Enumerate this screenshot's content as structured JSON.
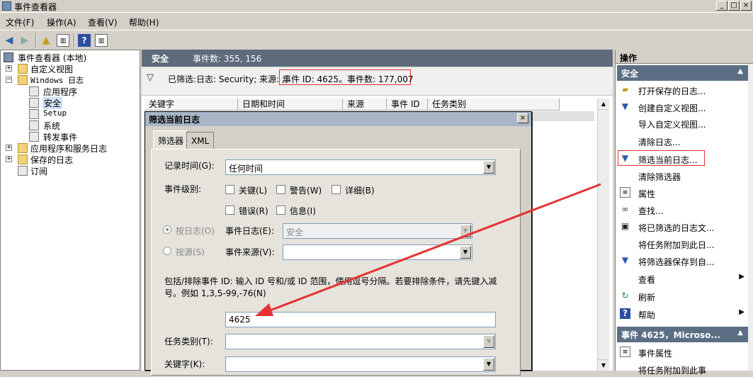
{
  "window": {
    "title": "事件查看器"
  },
  "menu": [
    "文件(F)",
    "操作(A)",
    "查看(V)",
    "帮助(H)"
  ],
  "tree": {
    "items": [
      {
        "label": "事件查看器 (本地)",
        "icon": "event-viewer-icon"
      },
      {
        "label": "自定义视图",
        "icon": "folder-icon"
      },
      {
        "label": "Windows 日志",
        "icon": "folder-icon"
      },
      {
        "label": "应用程序",
        "icon": "log-icon"
      },
      {
        "label": "安全",
        "icon": "log-icon"
      },
      {
        "label": "Setup",
        "icon": "log-icon"
      },
      {
        "label": "系统",
        "icon": "log-icon"
      },
      {
        "label": "转发事件",
        "icon": "log-icon"
      },
      {
        "label": "应用程序和服务日志",
        "icon": "folder-icon"
      },
      {
        "label": "保存的日志",
        "icon": "folder-icon"
      },
      {
        "label": "订阅",
        "icon": "subscription-icon"
      }
    ]
  },
  "center": {
    "log_name": "安全",
    "event_count": "事件数: 355, 156",
    "filter_text": "已筛选:日志: Security; 来源: ;",
    "filter_highlight": "事件 ID: 4625。事件数: 177,007",
    "columns": [
      "关键字",
      "日期和时间",
      "来源",
      "事件 ID",
      "任务类别"
    ]
  },
  "dialog": {
    "title": "筛选当前日志",
    "close": "×",
    "tabs": [
      "筛选器",
      "XML"
    ],
    "logged_label": "记录时间(G):",
    "logged_value": "任何时间",
    "level_label": "事件级别:",
    "levels": [
      "关键(L)",
      "警告(W)",
      "详细(B)",
      "错误(R)",
      "信息(I)"
    ],
    "by_log_label": "按日志(O)",
    "event_logs_label": "事件日志(E):",
    "event_logs_value": "安全",
    "by_source_label": "按源(S)",
    "event_sources_label": "事件来源(V):",
    "event_sources_value": "",
    "id_desc_line1": "包括/排除事件 ID: 输入 ID 号和/或 ID 范围，使用逗号分隔。若要排除条件，请先键入减",
    "id_desc_line2": "号。例如 1,3,5-99,-76(N)",
    "event_id_value": "4625",
    "task_label": "任务类别(T):",
    "task_value": "",
    "keywords_label": "关键字(K):",
    "keywords_value": ""
  },
  "actions": {
    "header": "操作",
    "section1": "安全",
    "items": [
      {
        "label": "打开保存的日志...",
        "icon": "open-folder-icon"
      },
      {
        "label": "创建自定义视图...",
        "icon": "filter-icon"
      },
      {
        "label": "导入自定义视图...",
        "icon": ""
      },
      {
        "label": "清除日志...",
        "icon": ""
      },
      {
        "label": "筛选当前日志...",
        "icon": "filter-icon"
      },
      {
        "label": "清除筛选器",
        "icon": ""
      },
      {
        "label": "属性",
        "icon": "properties-icon"
      },
      {
        "label": "查找...",
        "icon": "binoculars-icon"
      },
      {
        "label": "将已筛选的日志文...",
        "icon": "save-icon"
      },
      {
        "label": "将任务附加到此日...",
        "icon": ""
      },
      {
        "label": "将筛选器保存到自...",
        "icon": "filter-save-icon"
      },
      {
        "label": "查看",
        "icon": ""
      },
      {
        "label": "刷新",
        "icon": "refresh-icon"
      },
      {
        "label": "帮助",
        "icon": "help-icon"
      }
    ],
    "section2": "事件 4625，Microso...",
    "items2": [
      {
        "label": "事件属性",
        "icon": "properties-icon"
      },
      {
        "label": "将任务附加到此事",
        "icon": ""
      }
    ]
  },
  "colors": {
    "accent_red": "#e53333",
    "section_blue": "#5b6e84",
    "header_gray": "#5d6b7c"
  }
}
